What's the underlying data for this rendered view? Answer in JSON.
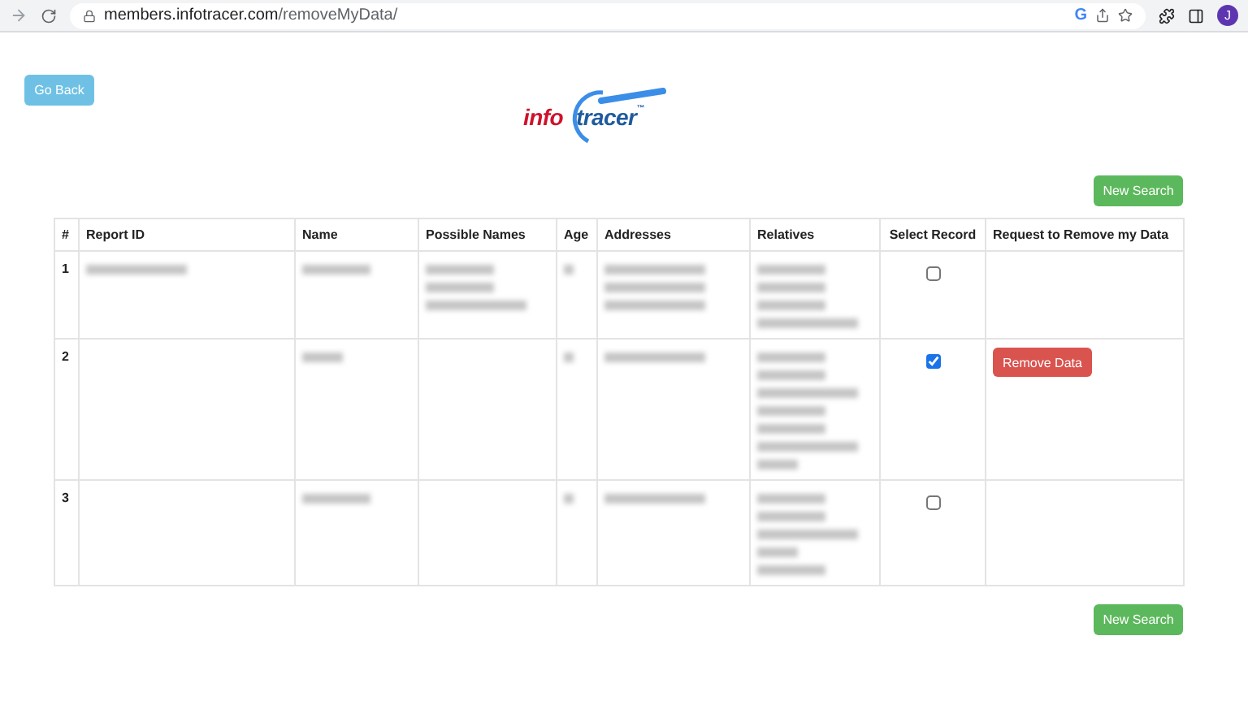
{
  "browser": {
    "url_host": "members.infotracer.com",
    "url_path": "/removeMyData/",
    "google_mark": "G",
    "profile_initial": "J"
  },
  "back_button": "Go Back",
  "logo": {
    "first": "info",
    "second": "tracer",
    "mark": "™"
  },
  "new_search_top": "New Search",
  "table": {
    "columns": [
      "#",
      "Report ID",
      "Name",
      "Possible Names",
      "Age",
      "Addresses",
      "Relatives",
      "Select Record",
      "Request to Remove my Data"
    ],
    "rows": [
      {
        "number": "1",
        "redacted": {
          "report_id": true,
          "name": true,
          "possible_names": true,
          "age": true,
          "addresses": true,
          "relatives": true
        },
        "selected": false
      },
      {
        "number": "2",
        "redacted": {
          "report_id": false,
          "name": true,
          "possible_names": false,
          "age": true,
          "addresses": true,
          "relatives": true
        },
        "selected": true,
        "action": "Remove Data"
      },
      {
        "number": "3",
        "redacted": {
          "report_id": false,
          "name": true,
          "possible_names": false,
          "age": true,
          "addresses": true,
          "relatives": true
        },
        "selected": false
      }
    ]
  },
  "new_search_bottom": "New Search"
}
